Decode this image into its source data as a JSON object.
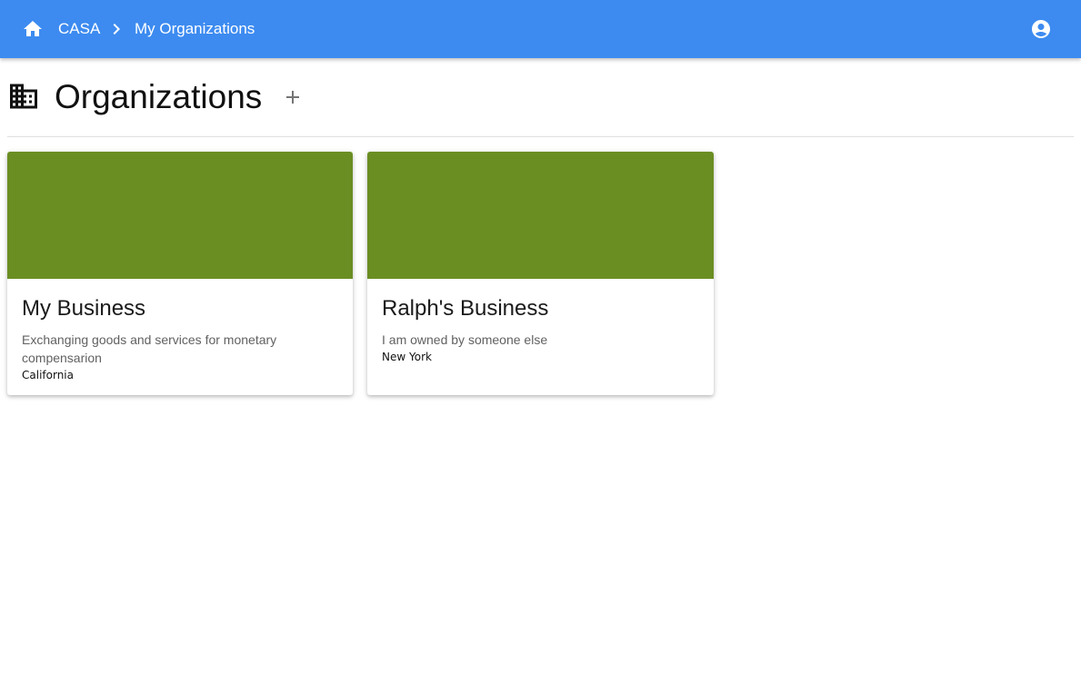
{
  "colors": {
    "app_bar": "#3d8bf0",
    "card_media": "#6b8e23"
  },
  "header": {
    "home_icon": "home-icon",
    "breadcrumb": {
      "root": "CASA",
      "separator_icon": "chevron-right-icon",
      "current": "My Organizations"
    },
    "account_icon": "account-circle-icon"
  },
  "page": {
    "title_icon": "domain-icon",
    "title": "Organizations",
    "add_icon": "plus-icon"
  },
  "organizations": [
    {
      "name": "My Business",
      "description": "Exchanging goods and services for monetary compensarion",
      "location": "California"
    },
    {
      "name": "Ralph's Business",
      "description": "I am owned by someone else",
      "location": "New York"
    }
  ]
}
